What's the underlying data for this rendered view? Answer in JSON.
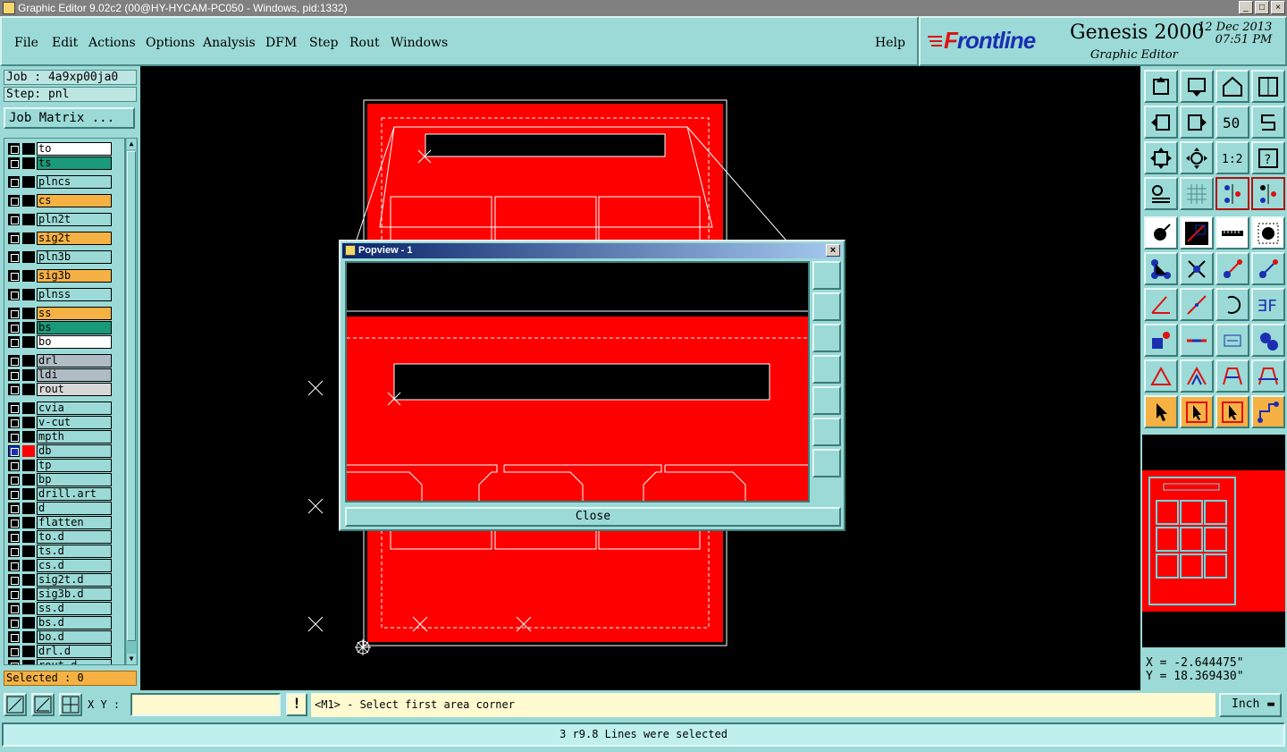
{
  "window": {
    "title": "Graphic Editor 9.02c2 (00@HY-HYCAM-PC050 - Windows, pid:1332)",
    "min": "_",
    "max": "□",
    "close": "×"
  },
  "menu": {
    "items": [
      "File",
      "Edit",
      "Actions",
      "Options",
      "Analysis",
      "DFM",
      "Step",
      "Rout",
      "Windows"
    ],
    "help": "Help"
  },
  "brand": {
    "logo_f": "F",
    "logo_rest": "rontline",
    "product": "Genesis 2000",
    "subtitle": "Graphic Editor",
    "date_line1": "12 Dec 2013",
    "date_line2": "07:51 PM"
  },
  "job": {
    "job_line": "Job : 4a9xp00ja0",
    "step_line": "Step: pnl",
    "matrix_button": "Job Matrix ..."
  },
  "layers": [
    {
      "name": "to",
      "color": "#ffffff"
    },
    {
      "name": "ts",
      "color": "#1a9a78"
    },
    {
      "name": "plncs",
      "color": "#9bdad6"
    },
    {
      "name": "cs",
      "color": "#f5b144"
    },
    {
      "name": "pln2t",
      "color": "#9bdad6"
    },
    {
      "name": "sig2t",
      "color": "#f5b144"
    },
    {
      "name": "pln3b",
      "color": "#9bdad6"
    },
    {
      "name": "sig3b",
      "color": "#f5b144"
    },
    {
      "name": "plnss",
      "color": "#9bdad6"
    },
    {
      "name": "ss",
      "color": "#f5b144"
    },
    {
      "name": "bs",
      "color": "#1a9a78"
    },
    {
      "name": "bo",
      "color": "#ffffff"
    },
    {
      "name": "drl",
      "color": "#b0bcc4"
    },
    {
      "name": "ldi",
      "color": "#b0bcc4"
    },
    {
      "name": "rout",
      "color": "#d8d8d8"
    },
    {
      "name": "cvia",
      "color": "#9bdad6"
    },
    {
      "name": "v-cut",
      "color": "#9bdad6"
    },
    {
      "name": "mpth",
      "color": "#9bdad6"
    },
    {
      "name": "db",
      "color": "#9bdad6"
    },
    {
      "name": "tp",
      "color": "#9bdad6"
    },
    {
      "name": "bp",
      "color": "#9bdad6"
    },
    {
      "name": "drill.art",
      "color": "#9bdad6"
    },
    {
      "name": "d",
      "color": "#9bdad6"
    },
    {
      "name": "flatten",
      "color": "#9bdad6"
    },
    {
      "name": "to.d",
      "color": "#9bdad6"
    },
    {
      "name": "ts.d",
      "color": "#9bdad6"
    },
    {
      "name": "cs.d",
      "color": "#9bdad6"
    },
    {
      "name": "sig2t.d",
      "color": "#9bdad6"
    },
    {
      "name": "sig3b.d",
      "color": "#9bdad6"
    },
    {
      "name": "ss.d",
      "color": "#9bdad6"
    },
    {
      "name": "bs.d",
      "color": "#9bdad6"
    },
    {
      "name": "bo.d",
      "color": "#9bdad6"
    },
    {
      "name": "drl.d",
      "color": "#9bdad6"
    },
    {
      "name": "rout.d",
      "color": "#9bdad6"
    }
  ],
  "selected_text": "Selected : 0",
  "coords": {
    "x": "X = -2.644475\"",
    "y": "Y = 18.369430\""
  },
  "command": {
    "xy_label": "X Y :",
    "xy_value": "",
    "excl": "!",
    "prompt": "<M1> - Select first area corner",
    "unit": "Inch"
  },
  "status": "3 r9.8 Lines were selected",
  "popview": {
    "title": "Popview - 1",
    "close_x": "×",
    "close_button": "Close"
  },
  "colors": {
    "board": "#ff0000",
    "outline": "#ffffff",
    "panel": "#9bdad6"
  }
}
